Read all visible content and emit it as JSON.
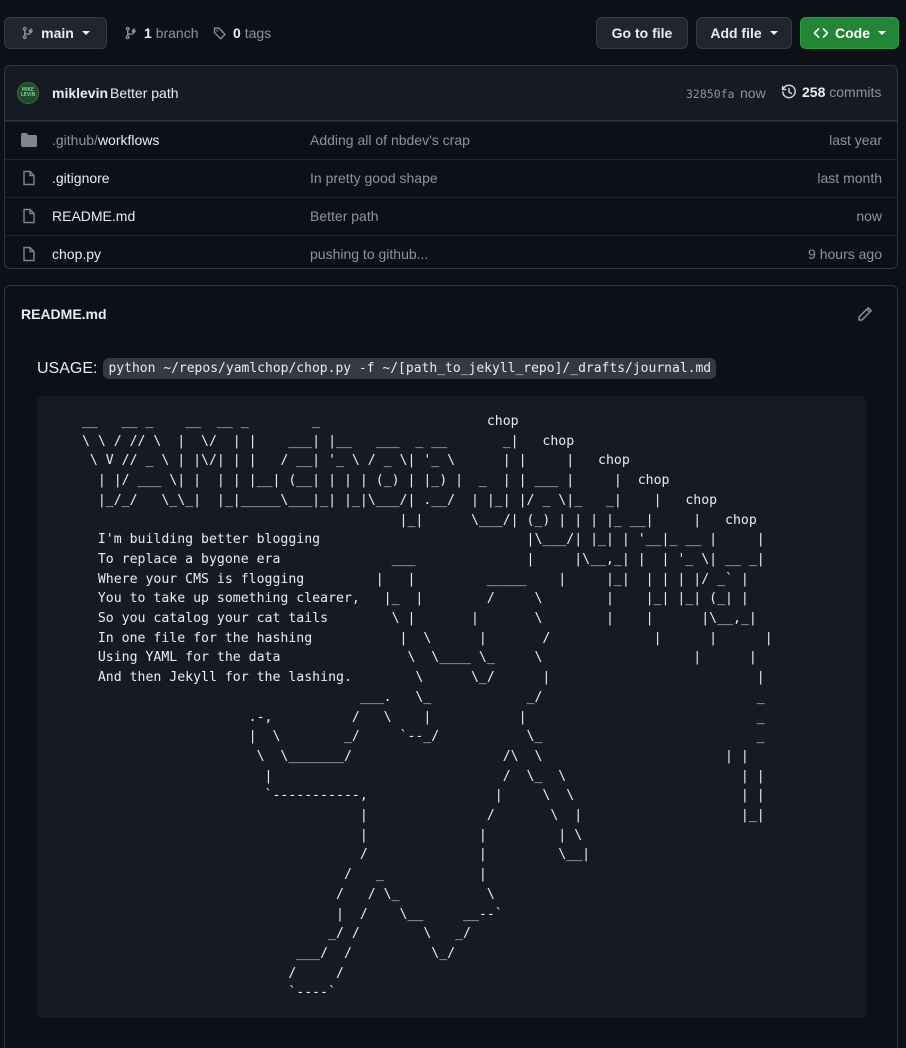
{
  "branch_selector": {
    "label": "main"
  },
  "branches": {
    "count": "1",
    "label": "branch"
  },
  "tags": {
    "count": "0",
    "label": "tags"
  },
  "actions": {
    "go_to_file": "Go to file",
    "add_file": "Add file",
    "code": "Code"
  },
  "latest_commit": {
    "author": "miklevin",
    "message": "Better path",
    "hash": "32850fa",
    "time": "now",
    "commit_count": "258",
    "commit_label": "commits"
  },
  "files": [
    {
      "dir_prefix": ".github/",
      "name": "workflows",
      "type": "folder",
      "message": "Adding all of nbdev's crap",
      "age": "last year"
    },
    {
      "name": ".gitignore",
      "type": "file",
      "message": "In pretty good shape",
      "age": "last month"
    },
    {
      "name": "README.md",
      "type": "file",
      "message": "Better path",
      "age": "now"
    },
    {
      "name": "chop.py",
      "type": "file",
      "message": "pushing to github...",
      "age": "9 hours ago"
    }
  ],
  "readme": {
    "title": "README.md",
    "usage_label": "USAGE:",
    "usage_command": "python ~/repos/yamlchop/chop.py -f ~/[path_to_jekyll_repo]/_drafts/journal.md",
    "ascii_art": " __   __ _    __  __ _        _                     chop\n \\ \\ / // \\  |  \\/  | |    ___| |__   ___  _ __       _|   chop\n  \\ V // _ \\ | |\\/| | |   / __| '_ \\ / _ \\| '_ \\      | |     |   chop\n   | |/ ___ \\| |  | | |__| (__| | | | (_) | |_) |  _  | | ___ |     |  chop\n   |_/_/   \\_\\_|  |_|_____\\___|_| |_|\\___/| .__/  | |_| |/ _ \\|_   _|    |   chop\n                                         |_|      \\___/| (_) | | | |_ __|     |   chop\n   I'm building better blogging                          |\\___/| |_| | '__|_ __ |     |\n   To replace a bygone era              ___              |     |\\__,_| |  | '_ \\| __ _|\n   Where your CMS is flogging         |   |         _____    |     |_|  | | | |/ _` |\n   You to take up something clearer,   |_  |        /     \\        |    |_| |_| (_| |\n   So you catalog your cat tails        \\ |       |       \\        |    |      |\\__,_|\n   In one file for the hashing           |  \\      |       /             |      |      |\n   Using YAML for the data                \\  \\____ \\_     \\                   |      |\n   And then Jekyll for the lashing.        \\      \\_/      |                          |\n                                    ___.   \\_            _/                           _\n                      .-,          /   \\    |           |                             _\n                      |  \\        _/     `--_/           \\_                           _\n                       \\  \\_______/                   /\\  \\                       | |\n                        |                             /  \\_  \\                      | |\n                        `-----------,                |     \\  \\                     | |\n                                    |               /       \\  |                    |_|\n                                    |              |         | \\\n                                    /              |         \\__|\n                                  /   _            |\n                                 /   / \\_           \\\n                                 |  /    \\__     __--`\n                                _/ /        \\   _/\n                            ___/  /          \\_/\n                           /     /\n                           `----`"
  }
}
